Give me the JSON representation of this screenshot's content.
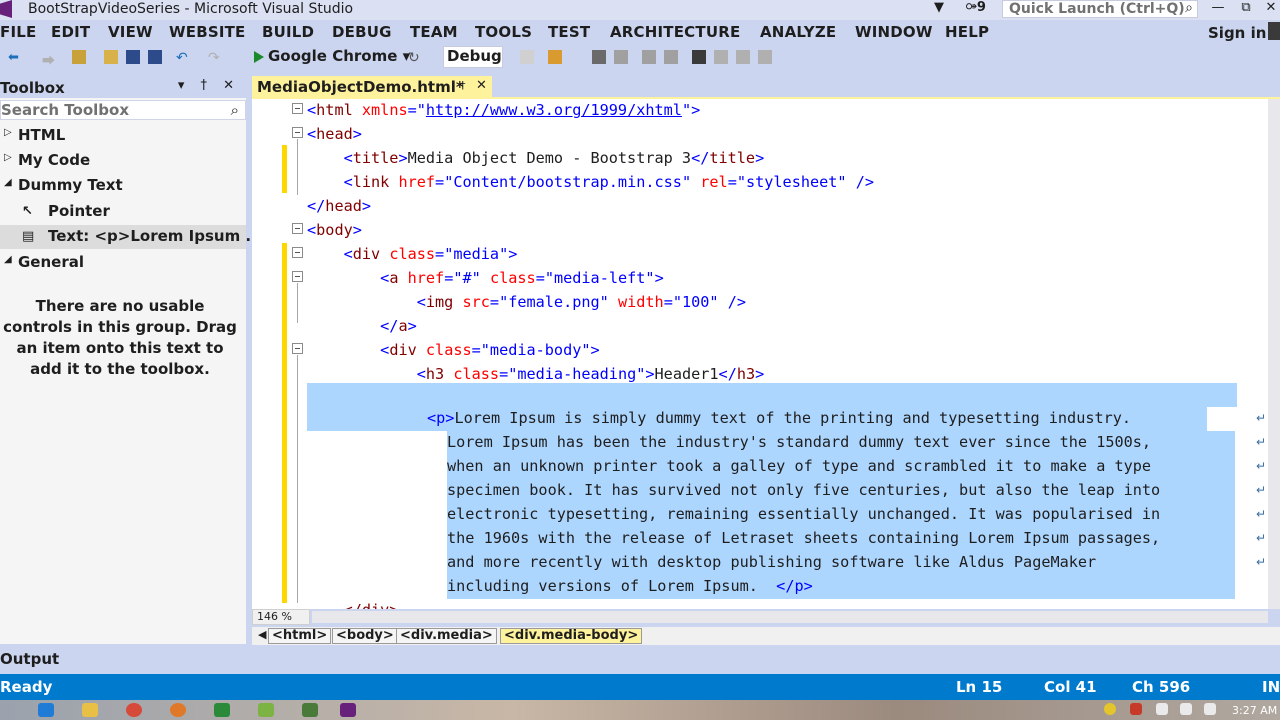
{
  "window": {
    "title": "BootStrapVideoSeries - Microsoft Visual Studio",
    "notifications": "▼",
    "feedback": "⚩9",
    "quick_launch_placeholder": "Quick Launch (Ctrl+Q)",
    "minimize": "—",
    "restore": "⧉",
    "close": "✕"
  },
  "menu": {
    "items": [
      "FILE",
      "EDIT",
      "VIEW",
      "WEBSITE",
      "BUILD",
      "DEBUG",
      "TEAM",
      "TOOLS",
      "TEST",
      "ARCHITECTURE",
      "ANALYZE",
      "WINDOW",
      "HELP"
    ],
    "sign_in": "Sign in"
  },
  "toolbar": {
    "run_target": "Google Chrome ▾",
    "configuration": "Debug"
  },
  "toolbox": {
    "title": "Toolbox",
    "controls": "▾ † ✕",
    "search_placeholder": "Search Toolbox",
    "groups": [
      {
        "label": "HTML",
        "arrow": "▷"
      },
      {
        "label": "My Code",
        "arrow": "▷"
      },
      {
        "label": "Dummy Text",
        "arrow": "◢"
      },
      {
        "label": "General",
        "arrow": "◢"
      }
    ],
    "items": [
      {
        "label": "Pointer",
        "icon": "↖"
      },
      {
        "label": "Text: <p>Lorem Ipsum ...",
        "icon": "▤"
      }
    ],
    "empty_message": "There are no usable controls in this group. Drag an item onto this text to add it to the toolbox."
  },
  "editor": {
    "tab_title": "MediaObjectDemo.html*",
    "tab_pin": "†",
    "tab_close": "✕",
    "zoom": "146 %",
    "lines": {
      "l1": "<html xmlns=\"http://www.w3.org/1999/xhtml\">",
      "l2": "<head>",
      "l3": "    <title>Media Object Demo - Bootstrap 3</title>",
      "l4": "    <link href=\"Content/bootstrap.min.css\" rel=\"stylesheet\" />",
      "l5": "</head>",
      "l6": "<body>",
      "l7": "    <div class=\"media\">",
      "l8": "        <a href=\"#\" class=\"media-left\">",
      "l9": "            <img src=\"female.png\" width=\"100\" />",
      "l10": "        </a>",
      "l11": "        <div class=\"media-body\">",
      "l12": "            <h3 class=\"media-heading\">Header1</h3>",
      "p_open": "<p>",
      "p1": "Lorem Ipsum is simply dummy text of the printing and typesetting industry.",
      "p2": "Lorem Ipsum has been the industry's standard dummy text ever since the 1500s,",
      "p3": "when an unknown printer took a galley of type and scrambled it to make a type",
      "p4": "specimen book. It has survived not only five centuries, but also the leap into",
      "p5": "electronic typesetting, remaining essentially unchanged. It was popularised in",
      "p6": "the 1960s with the release of Letraset sheets containing Lorem Ipsum passages,",
      "p7": "and more recently with desktop publishing software like Aldus PageMaker",
      "p8": "including versions of Lorem Ipsum.  ",
      "p_close": "</p>",
      "l_last": "    </div>"
    },
    "wrap_glyph": "↵"
  },
  "breadcrumbs": [
    "<html>",
    "<body>",
    "<div.media>",
    "<div.media-body>"
  ],
  "output": {
    "label": "Output"
  },
  "status": {
    "text": "Ready",
    "line": "Ln 15",
    "col": "Col 41",
    "ch": "Ch 596",
    "mode": "INS"
  },
  "taskbar": {
    "clock": "3:27 AM"
  },
  "colors": {
    "accent": "#007acc",
    "vs_purple": "#68217a",
    "tab_active": "#fff29d",
    "selection": "#add6ff"
  }
}
